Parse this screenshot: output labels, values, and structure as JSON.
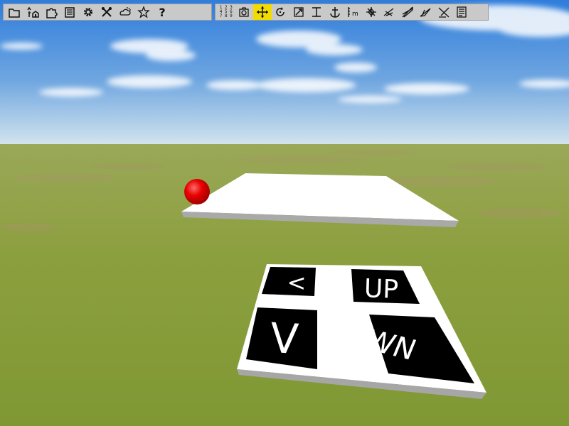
{
  "toolbar_left": [
    {
      "icon": "folder-icon",
      "name": "open-button"
    },
    {
      "icon": "tree-house-icon",
      "name": "environment-button"
    },
    {
      "icon": "puzzle-icon",
      "name": "blocks-button"
    },
    {
      "icon": "list-icon",
      "name": "list-button"
    },
    {
      "icon": "gear-icon",
      "name": "settings-button"
    },
    {
      "icon": "tools-icon",
      "name": "tools-button"
    },
    {
      "icon": "weather-icon",
      "name": "weather-button"
    },
    {
      "icon": "star-icon",
      "name": "favorite-button"
    },
    {
      "icon": "help-icon",
      "name": "help-button",
      "label": "?"
    }
  ],
  "toolbar_right": [
    {
      "icon": "number-grid-icon",
      "name": "numbers-button",
      "label": "1 2 3\n4 5 6\n7 8 9"
    },
    {
      "icon": "camera-icon",
      "name": "camera-button"
    },
    {
      "icon": "move-icon",
      "name": "move-button",
      "active": true
    },
    {
      "icon": "rotate-icon",
      "name": "rotate-button"
    },
    {
      "icon": "scale-icon",
      "name": "scale-button"
    },
    {
      "icon": "resize-vertical-icon",
      "name": "height-button"
    },
    {
      "icon": "anchor-icon",
      "name": "anchor-button"
    },
    {
      "icon": "measure-icon",
      "name": "measure-button"
    },
    {
      "icon": "transform-a-icon",
      "name": "transform-a-button"
    },
    {
      "icon": "transform-b-icon",
      "name": "transform-b-button"
    },
    {
      "icon": "transform-c-icon",
      "name": "transform-c-button"
    },
    {
      "icon": "transform-d-icon",
      "name": "transform-d-button"
    },
    {
      "icon": "transform-e-icon",
      "name": "transform-e-button"
    },
    {
      "icon": "document-icon",
      "name": "document-button"
    }
  ],
  "scene": {
    "panel_labels": {
      "left_up": "<",
      "left_down": "V",
      "right_up": "UP",
      "right_down": "DOWN"
    },
    "colors": {
      "sky_top": "#3a84de",
      "sky_bottom": "#d2e4ee",
      "grass": "#8a9c3c",
      "ball": "#e00000",
      "platform": "#ffffff",
      "panel_black": "#000000"
    }
  }
}
